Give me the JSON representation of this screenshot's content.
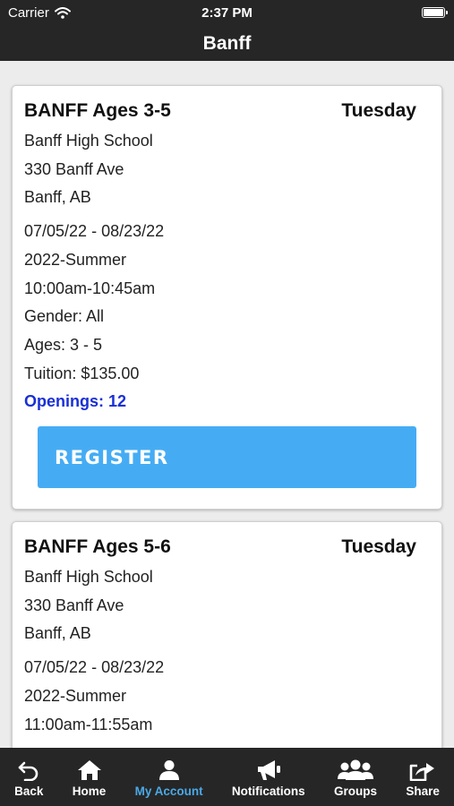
{
  "status_bar": {
    "carrier": "Carrier",
    "time": "2:37 PM"
  },
  "header": {
    "title": "Banff"
  },
  "classes": [
    {
      "name": "BANFF Ages 3-5",
      "day": "Tuesday",
      "school": "Banff High School",
      "street": "330 Banff Ave",
      "city": "Banff, AB",
      "dates": "07/05/22 - 08/23/22",
      "session": "2022-Summer",
      "time": "10:00am-10:45am",
      "gender": "Gender: All",
      "ages": "Ages: 3 - 5",
      "tuition": "Tuition: $135.00",
      "openings": "Openings: 12",
      "register_label": "REGISTER"
    },
    {
      "name": "BANFF Ages 5-6",
      "day": "Tuesday",
      "school": "Banff High School",
      "street": "330 Banff Ave",
      "city": "Banff, AB",
      "dates": "07/05/22 - 08/23/22",
      "session": "2022-Summer",
      "time": "11:00am-11:55am"
    }
  ],
  "tabbar": {
    "active": "My Account",
    "tabs": [
      {
        "label": "Back",
        "icon": "back-arrow-icon"
      },
      {
        "label": "Home",
        "icon": "home-icon"
      },
      {
        "label": "My Account",
        "icon": "user-icon"
      },
      {
        "label": "Notifications",
        "icon": "megaphone-icon"
      },
      {
        "label": "Groups",
        "icon": "group-icon"
      },
      {
        "label": "Share",
        "icon": "share-icon"
      }
    ]
  },
  "colors": {
    "bar_background": "#262626",
    "register_button": "#45acf4",
    "openings_text": "#1a2fd6",
    "active_tab": "#4aa9e8"
  }
}
